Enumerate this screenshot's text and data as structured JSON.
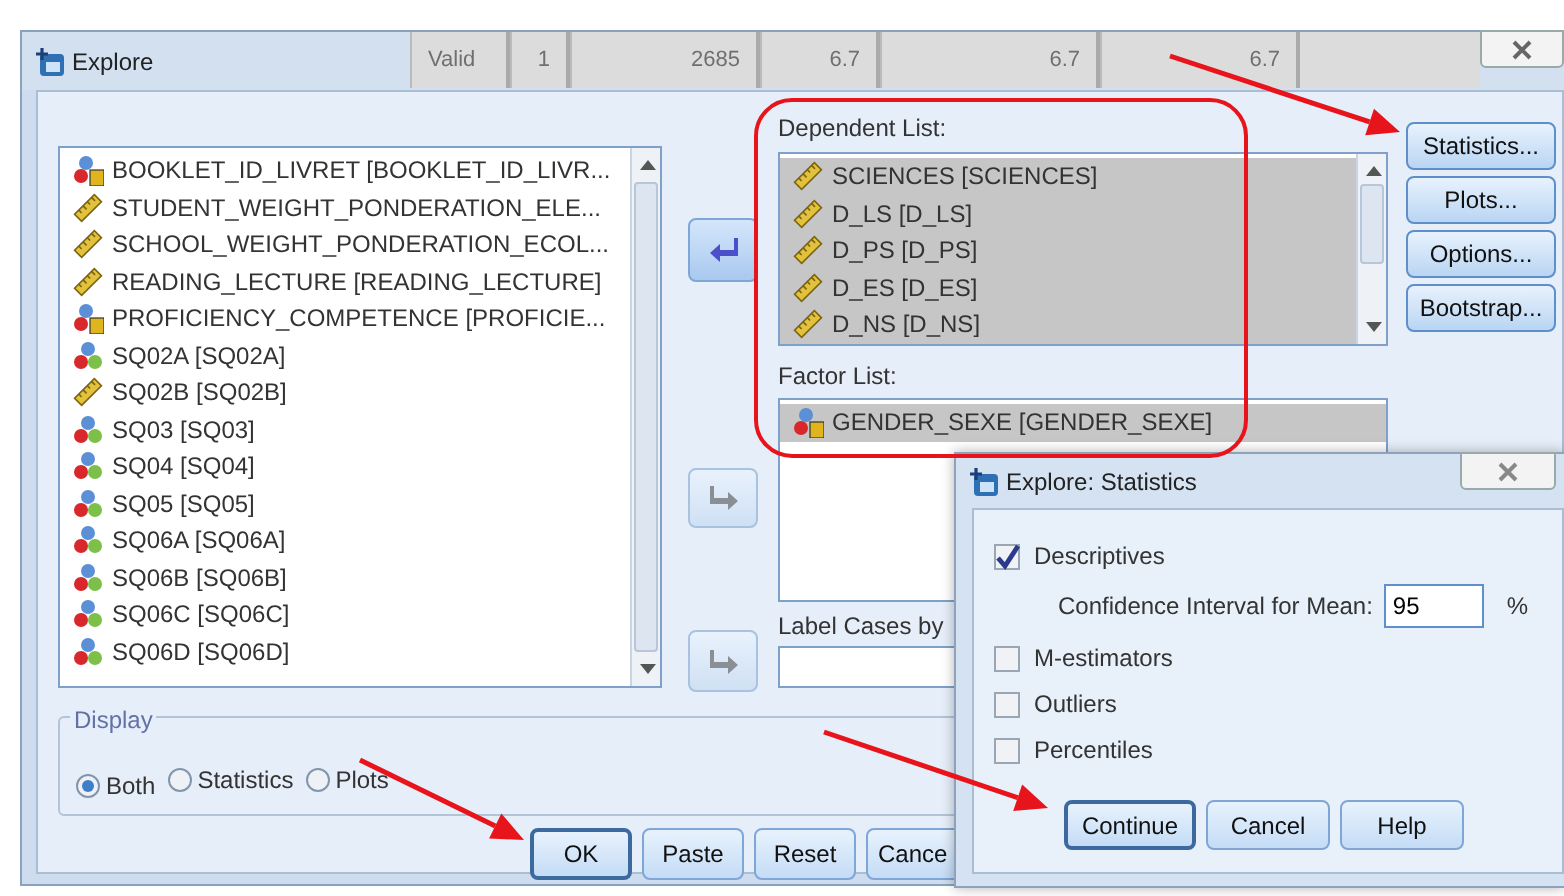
{
  "background_window": {
    "cells": [
      "Valid",
      "1",
      "2685",
      "6.7",
      "6.7",
      "6.7"
    ]
  },
  "window": {
    "title": "Explore"
  },
  "variables": [
    {
      "name": "BOOKLET_ID_LIVRET [BOOKLET_ID_LIVR...",
      "kind": "nominal_string"
    },
    {
      "name": "STUDENT_WEIGHT_PONDERATION_ELE...",
      "kind": "scale"
    },
    {
      "name": "SCHOOL_WEIGHT_PONDERATION_ECOL...",
      "kind": "scale"
    },
    {
      "name": "READING_LECTURE [READING_LECTURE]",
      "kind": "scale"
    },
    {
      "name": "PROFICIENCY_COMPETENCE [PROFICIE...",
      "kind": "nominal_string"
    },
    {
      "name": "SQ02A [SQ02A]",
      "kind": "nominal"
    },
    {
      "name": "SQ02B [SQ02B]",
      "kind": "scale"
    },
    {
      "name": "SQ03 [SQ03]",
      "kind": "nominal"
    },
    {
      "name": "SQ04 [SQ04]",
      "kind": "nominal"
    },
    {
      "name": "SQ05 [SQ05]",
      "kind": "nominal"
    },
    {
      "name": "SQ06A [SQ06A]",
      "kind": "nominal"
    },
    {
      "name": "SQ06B [SQ06B]",
      "kind": "nominal"
    },
    {
      "name": "SQ06C [SQ06C]",
      "kind": "nominal"
    },
    {
      "name": "SQ06D [SQ06D]",
      "kind": "nominal"
    }
  ],
  "move_buttons": [
    {
      "kind": "left",
      "disabled": false
    },
    {
      "kind": "right",
      "disabled": true
    },
    {
      "kind": "right",
      "disabled": true
    }
  ],
  "dependent_list": {
    "label": "Dependent List:",
    "items": [
      {
        "name": "SCIENCES [SCIENCES]",
        "kind": "scale",
        "selected": true
      },
      {
        "name": "D_LS [D_LS]",
        "kind": "scale",
        "selected": true
      },
      {
        "name": "D_PS [D_PS]",
        "kind": "scale",
        "selected": true
      },
      {
        "name": "D_ES [D_ES]",
        "kind": "scale",
        "selected": true
      },
      {
        "name": "D_NS [D_NS]",
        "kind": "scale",
        "selected": true
      }
    ]
  },
  "factor_list": {
    "label": "Factor List:",
    "items": [
      {
        "name": "GENDER_SEXE [GENDER_SEXE]",
        "kind": "nominal_string",
        "selected": true
      }
    ]
  },
  "label_cases": {
    "label": "Label Cases by"
  },
  "side_buttons": [
    "Statistics...",
    "Plots...",
    "Options...",
    "Bootstrap..."
  ],
  "display": {
    "legend": "Display",
    "options": [
      {
        "label": "Both",
        "selected": true
      },
      {
        "label": "Statistics",
        "selected": false
      },
      {
        "label": "Plots",
        "selected": false
      }
    ]
  },
  "buttons": [
    {
      "label": "OK",
      "default": true
    },
    {
      "label": "Paste",
      "default": false
    },
    {
      "label": "Reset",
      "default": false
    },
    {
      "label": "Cance",
      "default": false
    }
  ],
  "statistics_dialog": {
    "title": "Explore: Statistics",
    "options": [
      {
        "label": "Descriptives",
        "checked": true
      },
      {
        "label": "M-estimators",
        "checked": false
      },
      {
        "label": "Outliers",
        "checked": false
      },
      {
        "label": "Percentiles",
        "checked": false
      }
    ],
    "confidence": {
      "label": "Confidence Interval for Mean:",
      "value": "95",
      "unit": "%"
    },
    "buttons": [
      {
        "label": "Continue",
        "default": true
      },
      {
        "label": "Cancel",
        "default": false
      },
      {
        "label": "Help",
        "default": false
      }
    ]
  }
}
